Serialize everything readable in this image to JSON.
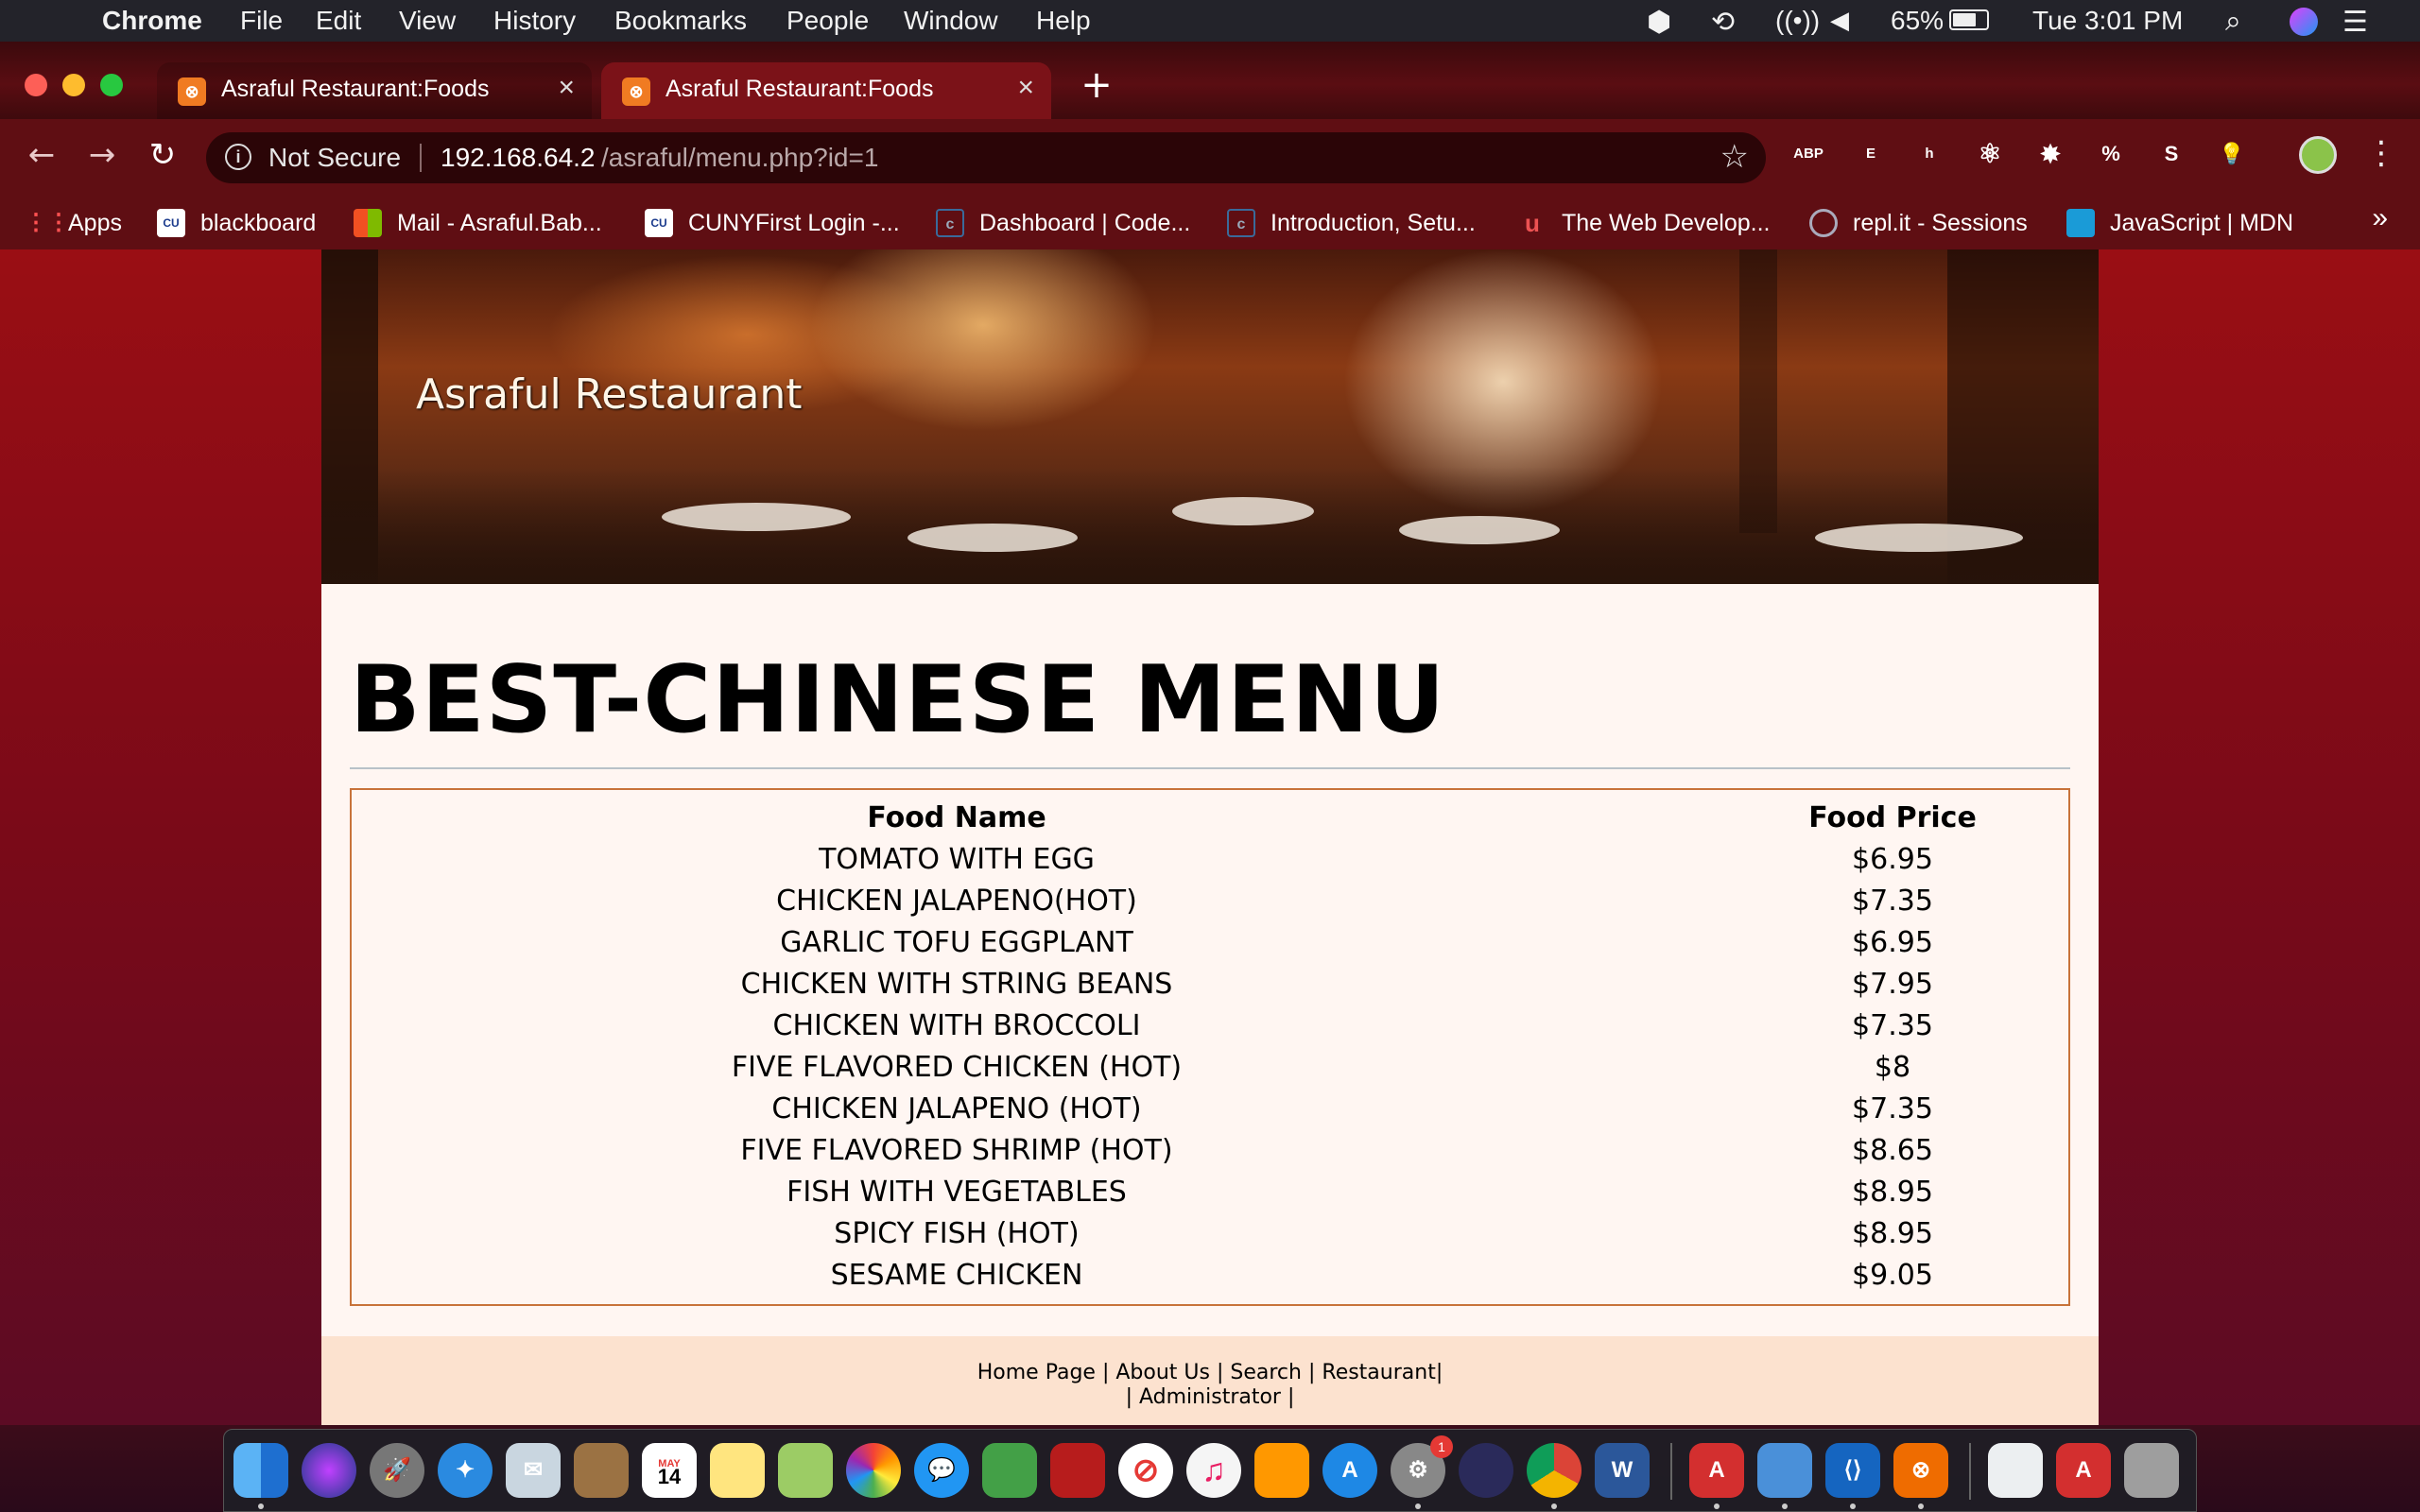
{
  "menubar": {
    "app": "Chrome",
    "items": [
      "File",
      "Edit",
      "View",
      "History",
      "Bookmarks",
      "People",
      "Window",
      "Help"
    ],
    "battery": "65%",
    "clock": "Tue 3:01 PM"
  },
  "tabs": [
    {
      "title": "Asraful Restaurant:Foods",
      "active": false
    },
    {
      "title": "Asraful Restaurant:Foods",
      "active": true
    }
  ],
  "omnibox": {
    "security": "Not Secure",
    "url_host": "192.168.64.2",
    "url_path": "/asraful/menu.php?id=1"
  },
  "extensions": [
    {
      "name": "adblock-plus-icon",
      "label": "ABP",
      "color": "#d9262b"
    },
    {
      "name": "evernote-icon",
      "label": "E",
      "color": "#2dbe60"
    },
    {
      "name": "honey-icon",
      "label": "h",
      "color": "#bdbdbd"
    },
    {
      "name": "react-devtools-icon",
      "label": "⚛",
      "color": "#6a0b10"
    },
    {
      "name": "extension-red-icon",
      "label": "✸",
      "color": "#e53935"
    },
    {
      "name": "percent-extension-icon",
      "label": "%",
      "color": "#f4511e"
    },
    {
      "name": "s-extension-icon",
      "label": "S",
      "color": "#1e88e5"
    },
    {
      "name": "lightbulb-extension-icon",
      "label": "💡",
      "color": "#6a0b10"
    }
  ],
  "bookmarks": [
    {
      "label": "Apps",
      "icon": "apps-grid-icon",
      "color": "#e53935"
    },
    {
      "label": "blackboard",
      "icon": "cuny-icon",
      "color": "#1a3a8c"
    },
    {
      "label": "Mail - Asraful.Bab...",
      "icon": "microsoft-icon",
      "color": "#f25022"
    },
    {
      "label": "CUNYFirst Login -...",
      "icon": "cuny-icon",
      "color": "#1a3a8c"
    },
    {
      "label": "Dashboard | Code...",
      "icon": "codecademy-icon",
      "color": "#204060"
    },
    {
      "label": "Introduction, Setu...",
      "icon": "codecademy-icon",
      "color": "#204060"
    },
    {
      "label": "The Web Develop...",
      "icon": "udemy-icon",
      "color": "#ec5252"
    },
    {
      "label": "repl.it - Sessions",
      "icon": "replit-icon",
      "color": "#889"
    },
    {
      "label": "JavaScript | MDN",
      "icon": "mdn-icon",
      "color": "#1a9bd7"
    }
  ],
  "site": {
    "title": "Asraful Restaurant",
    "heading": "BEST-CHINESE MENU"
  },
  "menu_table": {
    "headers": {
      "name": "Food Name",
      "price": "Food Price"
    },
    "rows": [
      {
        "name": "TOMATO WITH EGG",
        "price": "$6.95"
      },
      {
        "name": "CHICKEN JALAPENO(HOT)",
        "price": "$7.35"
      },
      {
        "name": "GARLIC TOFU EGGPLANT",
        "price": "$6.95"
      },
      {
        "name": "CHICKEN WITH STRING BEANS",
        "price": "$7.95"
      },
      {
        "name": "CHICKEN WITH BROCCOLI",
        "price": "$7.35"
      },
      {
        "name": "FIVE FLAVORED CHICKEN (HOT)",
        "price": "$8"
      },
      {
        "name": "CHICKEN JALAPENO (HOT)",
        "price": "$7.35"
      },
      {
        "name": "FIVE FLAVORED SHRIMP (HOT)",
        "price": "$8.65"
      },
      {
        "name": "FISH WITH VEGETABLES",
        "price": "$8.95"
      },
      {
        "name": "SPICY FISH (HOT)",
        "price": "$8.95"
      },
      {
        "name": "SESAME CHICKEN",
        "price": "$9.05"
      }
    ]
  },
  "footer": {
    "links": [
      "Home Page",
      "About Us",
      "Search",
      "Restaurant",
      "Administrator"
    ]
  },
  "dock": {
    "badge_count": "1",
    "calendar_month": "MAY",
    "calendar_day": "14"
  }
}
